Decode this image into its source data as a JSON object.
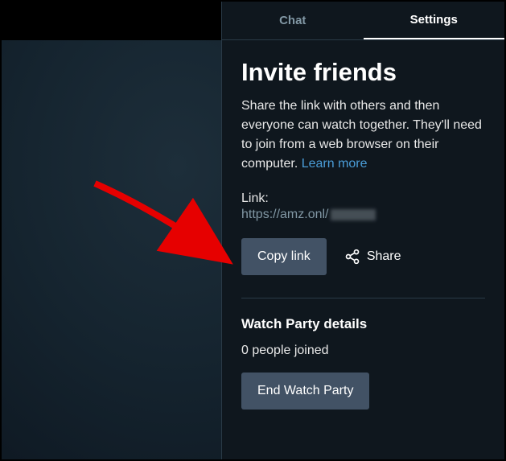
{
  "tabs": {
    "chat": "Chat",
    "settings": "Settings"
  },
  "settings": {
    "heading": "Invite friends",
    "description_pre": "Share the link with others and then everyone can watch together. They'll need to join from a web browser on their computer. ",
    "learn_more": "Learn more",
    "link_label": "Link:",
    "link_value": "https://amz.onl/",
    "copy_button": "Copy link",
    "share_label": "Share",
    "details_heading": "Watch Party details",
    "people_joined": "0 people joined",
    "end_button": "End Watch Party"
  }
}
